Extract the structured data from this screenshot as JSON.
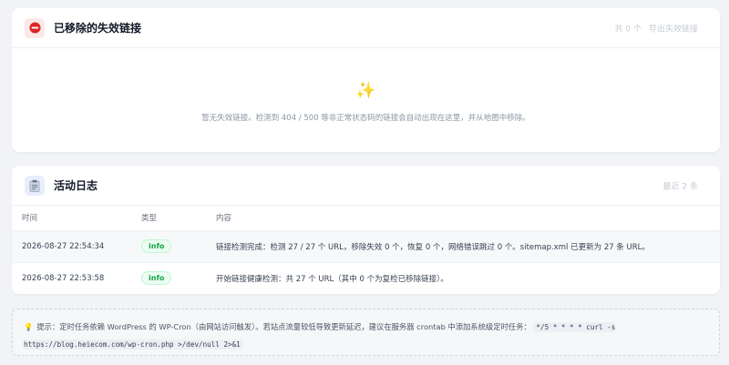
{
  "removed_links": {
    "title": "已移除的失效链接",
    "count_label": "共 0 个",
    "action_label": "导出失效链接",
    "icon": "no-entry-icon",
    "empty_icon": "sparkles-icon",
    "empty_message": "暂无失效链接。检测到 404 / 500 等非正常状态码的链接会自动出现在这里，并从地图中移除。"
  },
  "activity_log": {
    "title": "活动日志",
    "right_label": "最近 2 条",
    "icon": "clipboard-icon",
    "columns": [
      "时间",
      "类型",
      "内容"
    ],
    "rows": [
      {
        "time": "2026-08-27 22:54:34",
        "type": "info",
        "content": "链接检测完成：检测 27 / 27 个 URL，移除失效 0 个，恢复 0 个，网络错误跳过 0 个。sitemap.xml 已更新为 27 条 URL。"
      },
      {
        "time": "2026-08-27 22:53:58",
        "type": "info",
        "content": "开始链接健康检测：共 27 个 URL（其中 0 个为复检已移除链接）。"
      }
    ]
  },
  "tip": {
    "icon": "lightbulb-icon",
    "text": "提示：定时任务依赖 WordPress 的 WP-Cron（由网站访问触发）。若站点流量较低导致更新延迟，建议在服务器 crontab 中添加系统级定时任务：",
    "code": "*/5 * * * * curl -s https://blog.heiecom.com/wp-cron.php >/dev/null 2>&1"
  },
  "colors": {
    "accent_success": "#16a34a",
    "danger": "#dc2626",
    "page_bg": "#f1f3f6"
  }
}
